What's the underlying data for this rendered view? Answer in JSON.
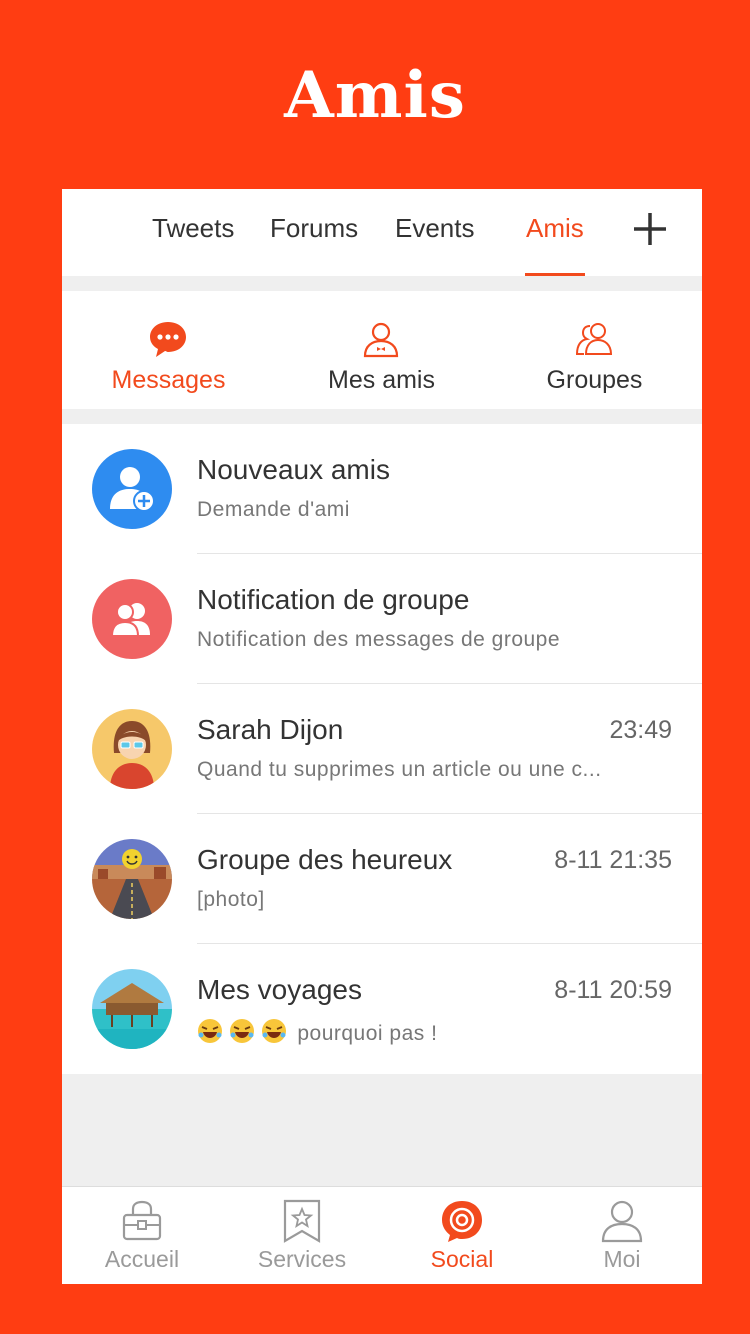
{
  "hero": {
    "title": "Amis"
  },
  "topnav": {
    "tabs": [
      "Tweets",
      "Forums",
      "Events",
      "Amis"
    ],
    "active_tab": "Amis",
    "add_icon": "plus-icon"
  },
  "segment": {
    "items": [
      {
        "label": "Messages",
        "icon": "chat-bubble-icon",
        "active": true
      },
      {
        "label": "Mes amis",
        "icon": "user-icon",
        "active": false
      },
      {
        "label": "Groupes",
        "icon": "group-icon",
        "active": false
      }
    ]
  },
  "list": [
    {
      "name": "Nouveaux amis",
      "sub": "Demande d'ami",
      "time": "",
      "avatar": "add-friend-icon",
      "avatar_color": "#2E8CF0"
    },
    {
      "name": "Notification de groupe",
      "sub": "Notification des messages de groupe",
      "time": "",
      "avatar": "group-notification-icon",
      "avatar_color": "#F06262"
    },
    {
      "name": "Sarah Dijon",
      "sub": "Quand tu supprimes un article ou une c...",
      "time": "23:49",
      "avatar": "woman-avatar"
    },
    {
      "name": "Groupe des heureux",
      "sub": "[photo]",
      "time": "8-11 21:35",
      "avatar": "desert-road-smiley-avatar"
    },
    {
      "name": "Mes voyages",
      "sub": "pourquoi pas !",
      "time": "8-11 20:59",
      "avatar": "tropical-bungalow-avatar"
    }
  ],
  "tabbar": {
    "items": [
      {
        "label": "Accueil",
        "icon": "shopping-bag-icon",
        "active": false
      },
      {
        "label": "Services",
        "icon": "bookmark-star-icon",
        "active": false
      },
      {
        "label": "Social",
        "icon": "social-target-icon",
        "active": true
      },
      {
        "label": "Moi",
        "icon": "person-icon",
        "active": false
      }
    ]
  },
  "colors": {
    "brand": "#FF3D12",
    "accent": "#F24A1D",
    "background": "#EFEFEF"
  }
}
